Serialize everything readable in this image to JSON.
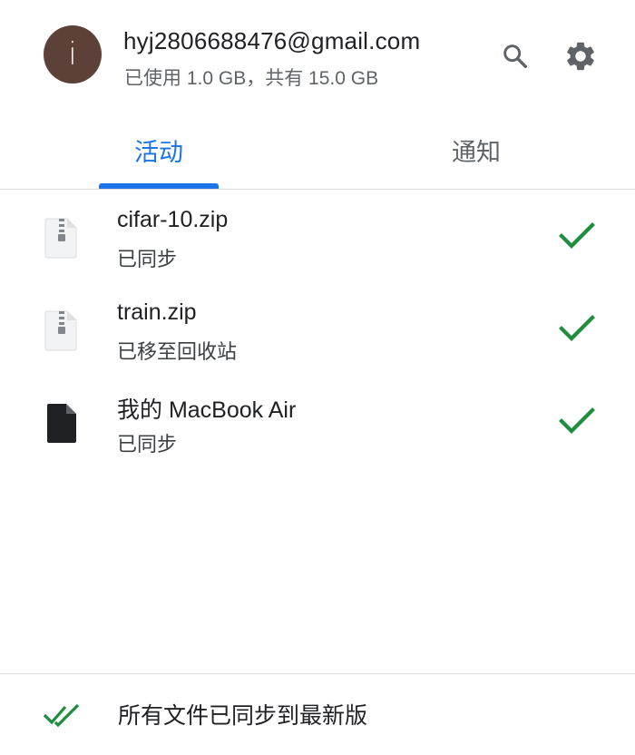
{
  "account": {
    "avatar_letter": "i",
    "avatar_color": "#5d4037",
    "email": "hyj2806688476@gmail.com",
    "storage": "已使用 1.0 GB，共有 15.0 GB"
  },
  "toolbar": {
    "search_icon": "search-icon",
    "settings_icon": "gear-icon"
  },
  "tabs": [
    {
      "label": "活动",
      "active": true
    },
    {
      "label": "通知",
      "active": false
    }
  ],
  "colors": {
    "accent": "#1a73e8",
    "check": "#1e8e3e"
  },
  "items": [
    {
      "name": "cifar-10.zip",
      "status": "已同步",
      "icon": "zip-file-icon"
    },
    {
      "name": "train.zip",
      "status": "已移至回收站",
      "icon": "zip-file-icon"
    },
    {
      "name": "我的 MacBook Air",
      "status": "已同步",
      "icon": "document-icon"
    }
  ],
  "footer": {
    "icon": "double-check-icon",
    "text": "所有文件已同步到最新版"
  }
}
